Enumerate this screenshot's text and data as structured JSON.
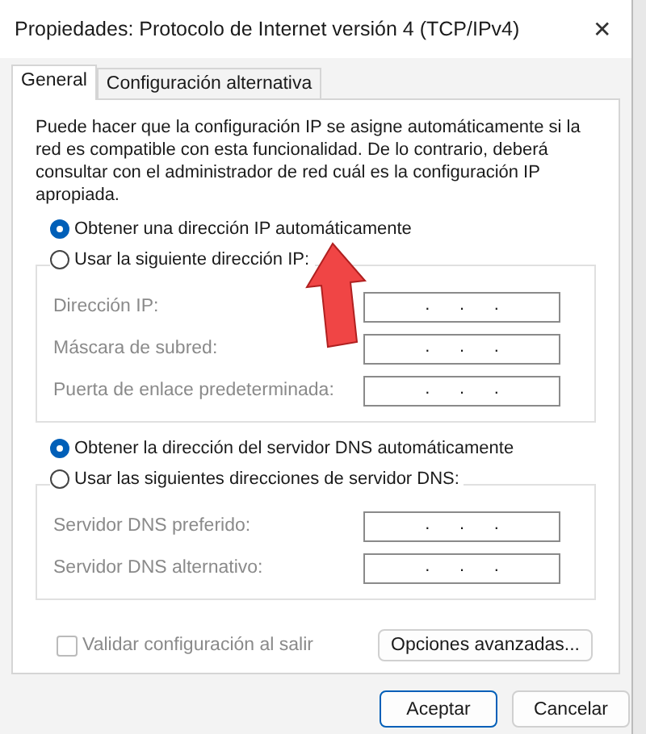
{
  "window": {
    "title": "Propiedades: Protocolo de Internet versión 4 (TCP/IPv4)",
    "close": "✕"
  },
  "tabs": [
    {
      "label": "General",
      "selected": true
    },
    {
      "label": "Configuración alternativa",
      "selected": false
    }
  ],
  "description": "Puede hacer que la configuración IP se asigne automáticamente si la red es compatible con esta funcionalidad. De lo contrario, deberá consultar con el administrador de red cuál es la configuración IP apropiada.",
  "ip_auto": {
    "label": "Obtener una dirección IP automáticamente",
    "selected": true
  },
  "ip_group": {
    "label": "Usar la siguiente dirección IP:",
    "selected": false,
    "disabled": true,
    "fields": [
      {
        "label": "Dirección IP:",
        "value": ".      .      ."
      },
      {
        "label": "Máscara de subred:",
        "value": ".      .      ."
      },
      {
        "label": "Puerta de enlace predeterminada:",
        "value": ".      .      ."
      }
    ]
  },
  "dns_auto": {
    "label": "Obtener la dirección del servidor DNS automáticamente",
    "selected": true
  },
  "dns_group": {
    "label": "Usar las siguientes direcciones de servidor DNS:",
    "selected": false,
    "disabled": true,
    "fields": [
      {
        "label": "Servidor DNS preferido:",
        "value": ".      .      ."
      },
      {
        "label": "Servidor DNS alternativo:",
        "value": ".      .      ."
      }
    ]
  },
  "validate": {
    "label": "Validar configuración al salir",
    "checked": false,
    "disabled": true
  },
  "advanced_button": "Opciones avanzadas...",
  "buttons": [
    {
      "label": "Aceptar",
      "default": true
    },
    {
      "label": "Cancelar",
      "default": false
    }
  ]
}
